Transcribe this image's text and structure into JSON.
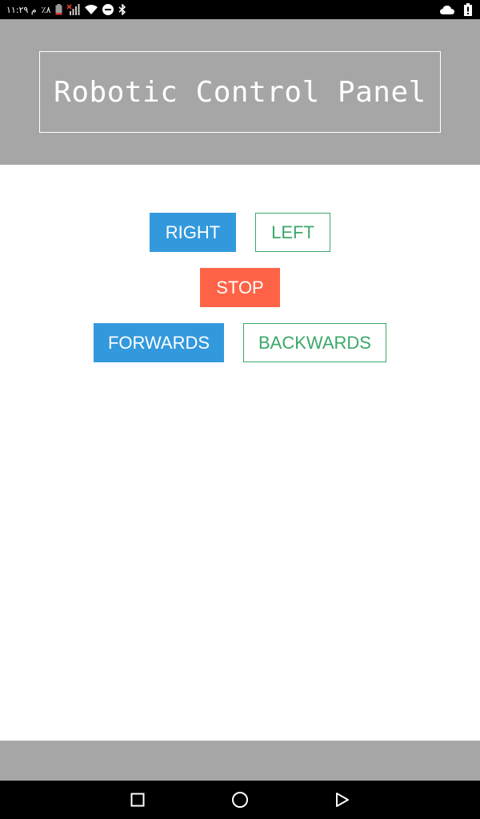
{
  "status_bar": {
    "time": "۱۱:۲۹ م",
    "battery_percent": "٪۸",
    "icons": [
      "battery-low-icon",
      "signal-x-icon",
      "wifi-icon",
      "do-not-disturb-icon",
      "bluetooth-icon",
      "cloud-icon",
      "battery-alert-icon"
    ]
  },
  "header": {
    "title": "Robotic Control Panel"
  },
  "controls": {
    "right_label": "RIGHT",
    "left_label": "LEFT",
    "stop_label": "STOP",
    "forwards_label": "FORWARDS",
    "backwards_label": "BACKWARDS"
  },
  "colors": {
    "header_bg": "#a6a6a6",
    "primary_blue": "#3399dd",
    "stop_red": "#ff6347",
    "outline_green": "#3aa86a"
  },
  "navigation": {
    "icons": [
      "recents-square-icon",
      "home-circle-icon",
      "back-triangle-icon"
    ]
  }
}
